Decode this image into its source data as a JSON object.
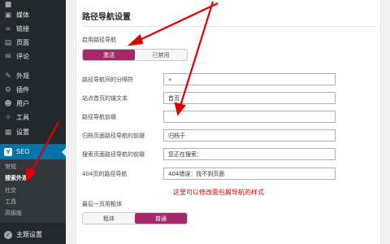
{
  "sidebar": {
    "items": [
      {
        "label": "",
        "icon": "media-icon"
      },
      {
        "label": "媒体",
        "icon": "media-icon"
      },
      {
        "label": "链接",
        "icon": "link-icon"
      },
      {
        "label": "页面",
        "icon": "page-icon"
      },
      {
        "label": "评论",
        "icon": "comment-icon"
      },
      {
        "label": "外观",
        "icon": "brush-icon"
      },
      {
        "label": "插件",
        "icon": "plugin-icon"
      },
      {
        "label": "用户",
        "icon": "user-icon"
      },
      {
        "label": "工具",
        "icon": "wrench-icon"
      },
      {
        "label": "设置",
        "icon": "settings-icon"
      }
    ],
    "seo": {
      "label": "SEO",
      "icon": "yoast-icon"
    },
    "submenu": [
      "常规",
      "搜索外观",
      "社交",
      "工具",
      "高级版"
    ],
    "bottom": {
      "label": "主题设置",
      "icon": "theme-settings-icon"
    },
    "accent": "#0073aa"
  },
  "panel": {
    "title": "路径导航设置",
    "enable": {
      "label": "启用路径导航",
      "options": [
        "激活",
        "已禁用"
      ],
      "selected": "激活"
    },
    "fields": [
      {
        "label": "路径导航间的分隔符",
        "value": "»"
      },
      {
        "label": "站点首页的锚文本",
        "value": "首页"
      },
      {
        "label": "路径导航前缀",
        "value": ""
      },
      {
        "label": "归档页面路径导航的前缀",
        "value": "归档于"
      },
      {
        "label": "搜索页面路径导航的前缀",
        "value": "您正在搜索："
      },
      {
        "label": "404页的路径导航",
        "value": "404错误：找不到页面"
      }
    ],
    "bold_last": {
      "label": "最后一页用粗体",
      "options": [
        "粗体",
        "普通"
      ],
      "selected": "普通"
    },
    "accent": "#a4286a"
  },
  "annotation": "这里可以修改面包屑导航的样式",
  "annotation_color": "#e00000"
}
